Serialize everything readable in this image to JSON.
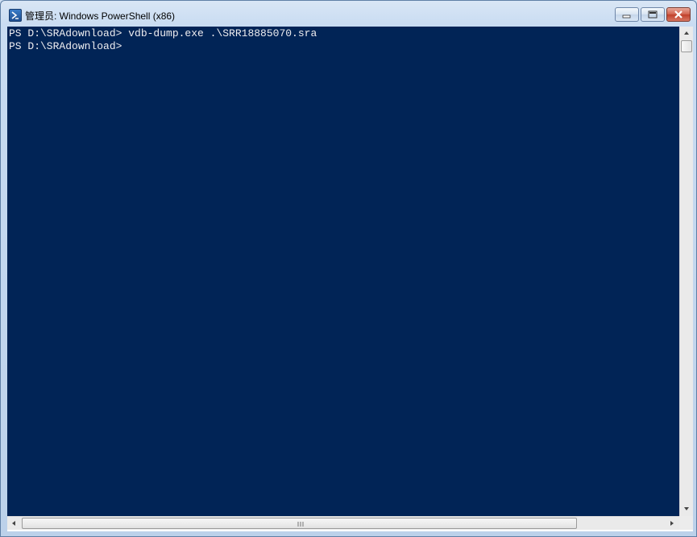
{
  "window": {
    "title": "管理员: Windows PowerShell (x86)",
    "icon": "powershell-icon"
  },
  "controls": {
    "minimize": "minimize-icon",
    "maximize": "maximize-icon",
    "close": "close-icon"
  },
  "console": {
    "background": "#012456",
    "foreground": "#eeedf0",
    "lines": [
      "PS D:\\SRAdownload> vdb-dump.exe .\\SRR18885070.sra",
      "PS D:\\SRAdownload>"
    ]
  }
}
